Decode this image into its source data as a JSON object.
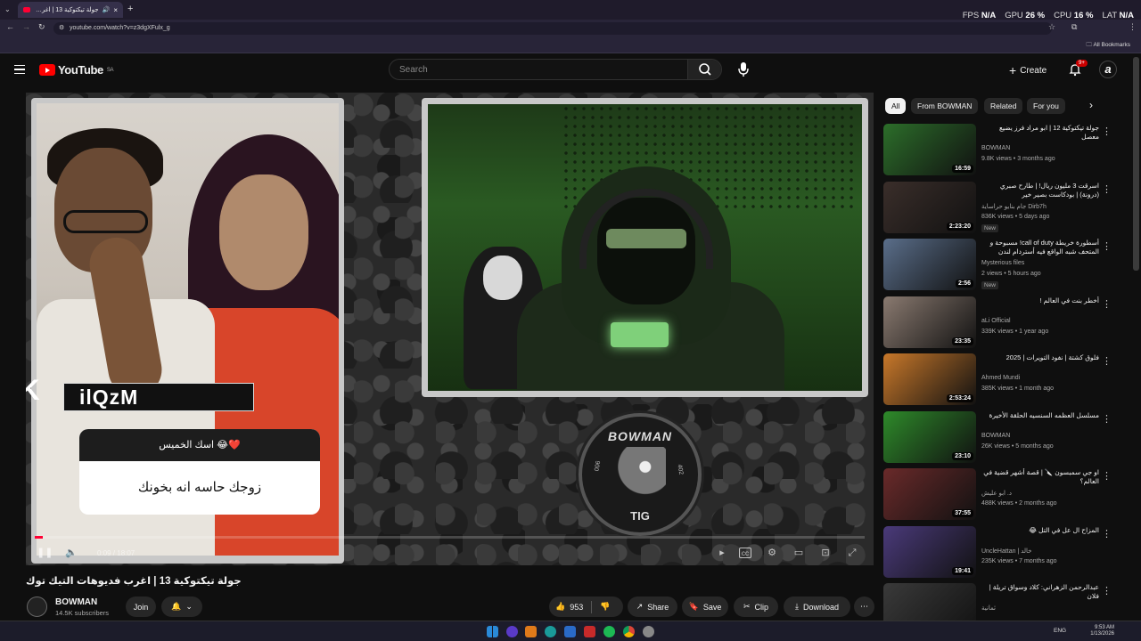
{
  "browser": {
    "tab_title": "جولة تيكتوكية 13 | اغرب (123)",
    "url": "youtube.com/watch?v=z3dgXFulx_g",
    "all_bookmarks": "All Bookmarks",
    "perf": {
      "fps_label": "FPS",
      "fps": "N/A",
      "gpu_label": "GPU",
      "gpu": "26 %",
      "cpu_label": "CPU",
      "cpu": "16 %",
      "lat_label": "LAT",
      "lat": "N/A"
    }
  },
  "youtube": {
    "logo_text": "YouTube",
    "logo_region": "SA",
    "search_placeholder": "Search",
    "create_label": "Create",
    "notif_badge": "9+",
    "account_initial": "a"
  },
  "player": {
    "overlay_name": "ilQzM",
    "question": "اسك الخميس 😂❤️",
    "answer": "زوجك حاسه انه بخونك",
    "emblem_top": "BOWMAN",
    "emblem_bottom": "TIG",
    "emblem_left": "006",
    "emblem_right": "402",
    "time": "0:09 / 18:07",
    "progress": 0.01
  },
  "video": {
    "title": "جولة تيكتوكية 13 | اغرب فديوهات التيك توك",
    "channel": "BOWMAN",
    "subscribers": "14.5K subscribers",
    "join": "Join",
    "likes": "953",
    "share": "Share",
    "save": "Save",
    "clip": "Clip",
    "download": "Download"
  },
  "sidebar": {
    "chips": [
      "All",
      "From BOWMAN",
      "Related",
      "For you"
    ],
    "items": [
      {
        "title": "جولة تيكتوكية 12 | ابو مراد فرز يضيع معصل",
        "channel": "BOWMAN",
        "meta": "9.8K views • 3 months ago",
        "duration": "16:59",
        "new": "",
        "color": "#2c6e2a"
      },
      {
        "title": "اسرقت 3 مليون ريال! | طارح صبري (درونة) | بودكاست بصير خير",
        "channel": "جام بنايو حراساية Dirb7h",
        "meta": "836K views • 5 days ago",
        "duration": "2:23:20",
        "new": "New",
        "color": "#3a2e2a"
      },
      {
        "title": "أسطورة خريطة call of duty! مسبوحة و المتحف شبه الواقع فيه أستردام لندن",
        "channel": "Mysterious files",
        "meta": "2 views • 5 hours ago",
        "duration": "2:56",
        "new": "New",
        "color": "#5a6e8a"
      },
      {
        "title": "أخطر بنت في العالم !",
        "channel": "aLi Official",
        "meta": "339K views • 1 year ago",
        "duration": "23:35",
        "new": "",
        "color": "#8a7a70"
      },
      {
        "title": "فلوق كشتة | نفود التويرات | 2025",
        "channel": "Ahmed Mundi",
        "meta": "385K views • 1 month ago",
        "duration": "2:53:24",
        "new": "",
        "color": "#c8782a"
      },
      {
        "title": "مسلسل العظمه السنسيه الحلقة الأخيرة",
        "channel": "BOWMAN",
        "meta": "26K views • 5 months ago",
        "duration": "23:10",
        "new": "",
        "color": "#2e8a2a"
      },
      {
        "title": "او جي سمبسون 🔪 | قصة أشهر قضية في العالم؟",
        "channel": "د. ابو عليش",
        "meta": "488K views • 2 months ago",
        "duration": "37:55",
        "new": "",
        "color": "#6a2a2a"
      },
      {
        "title": "المزاح ال عل في التل 😂",
        "channel": "UncleHattan | خالد",
        "meta": "235K views • 7 months ago",
        "duration": "19:41",
        "new": "",
        "color": "#4a3a7a"
      },
      {
        "title": "عبدالرحمن الزهراني: كلاد وسواق تريلة | فلان",
        "channel": "ثمانية",
        "meta": "",
        "duration": "",
        "new": "",
        "color": "#3a3a3a"
      }
    ]
  },
  "taskbar": {
    "lang": "ENG",
    "time": "9:53 AM",
    "date": "1/13/2026"
  }
}
